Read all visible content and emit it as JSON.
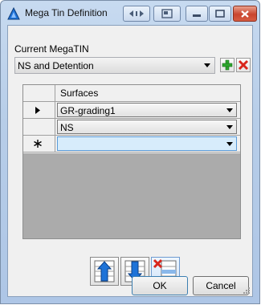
{
  "window": {
    "title": "Mega Tin Definition"
  },
  "current_megatin": {
    "label": "Current MegaTIN",
    "selected": "NS and Detention"
  },
  "grid": {
    "column_header": "Surfaces",
    "rows": [
      {
        "value": "GR-grading1",
        "indicator": "current"
      },
      {
        "value": "NS",
        "indicator": "none"
      },
      {
        "value": "",
        "indicator": "new"
      }
    ]
  },
  "buttons": {
    "ok": "OK",
    "cancel": "Cancel"
  },
  "colors": {
    "accent_blue": "#1e73d8",
    "add_green": "#2ea62e",
    "delete_red": "#d9261c",
    "selected_cell": "#d7ecfb"
  }
}
